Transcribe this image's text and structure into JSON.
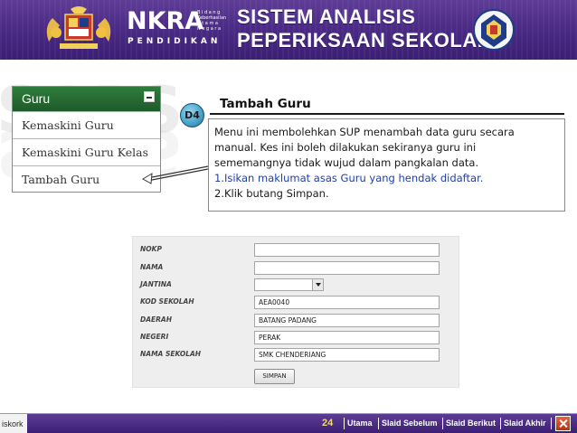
{
  "banner": {
    "logo_main": "NKRA",
    "logo_sub_lines": [
      "B i d a n g",
      "Keberhasilan",
      "U t a m a",
      "N e g a r a"
    ],
    "logo_tagline": "PENDIDIKAN",
    "title_line1": "SISTEM ANALISIS",
    "title_line2": "PEPERIKSAAN SEKOLAH"
  },
  "watermark": {
    "text": "SAPS"
  },
  "menu": {
    "header": "Guru",
    "items": [
      {
        "label": "Kemaskini Guru"
      },
      {
        "label": "Kemaskini Guru Kelas"
      },
      {
        "label": "Tambah Guru"
      }
    ]
  },
  "callout": {
    "badge": "D4",
    "title": "Tambah Guru",
    "lines": [
      "Menu ini membolehkan SUP menambah data guru secara",
      "manual. Kes ini boleh dilakukan sekiranya guru ini",
      "sememangnya tidak wujud dalam pangkalan data."
    ],
    "steps": [
      "1.Isikan maklumat asas Guru yang hendak didaftar.",
      "2.Klik butang Simpan."
    ]
  },
  "form": {
    "fields": [
      {
        "label": "NOKP",
        "value": ""
      },
      {
        "label": "NAMA",
        "value": ""
      },
      {
        "label": "JANTINA",
        "value": ""
      },
      {
        "label": "KOD SEKOLAH",
        "value": "AEA0040"
      },
      {
        "label": "DAERAH",
        "value": "BATANG PADANG"
      },
      {
        "label": "NEGERI",
        "value": "PERAK"
      },
      {
        "label": "NAMA SEKOLAH",
        "value": "SMK CHENDERIANG"
      }
    ],
    "submit_label": "SIMPAN"
  },
  "footer": {
    "brand": "iskork",
    "page": "24",
    "nav": [
      "Utama",
      "Slaid Sebelum",
      "Slaid Berikut",
      "Slaid Akhir"
    ]
  },
  "colors": {
    "banner": "#4b2b86",
    "menu_header": "#2e7d3c",
    "step_text": "#1f3faa",
    "footer_page": "#f1d779"
  }
}
